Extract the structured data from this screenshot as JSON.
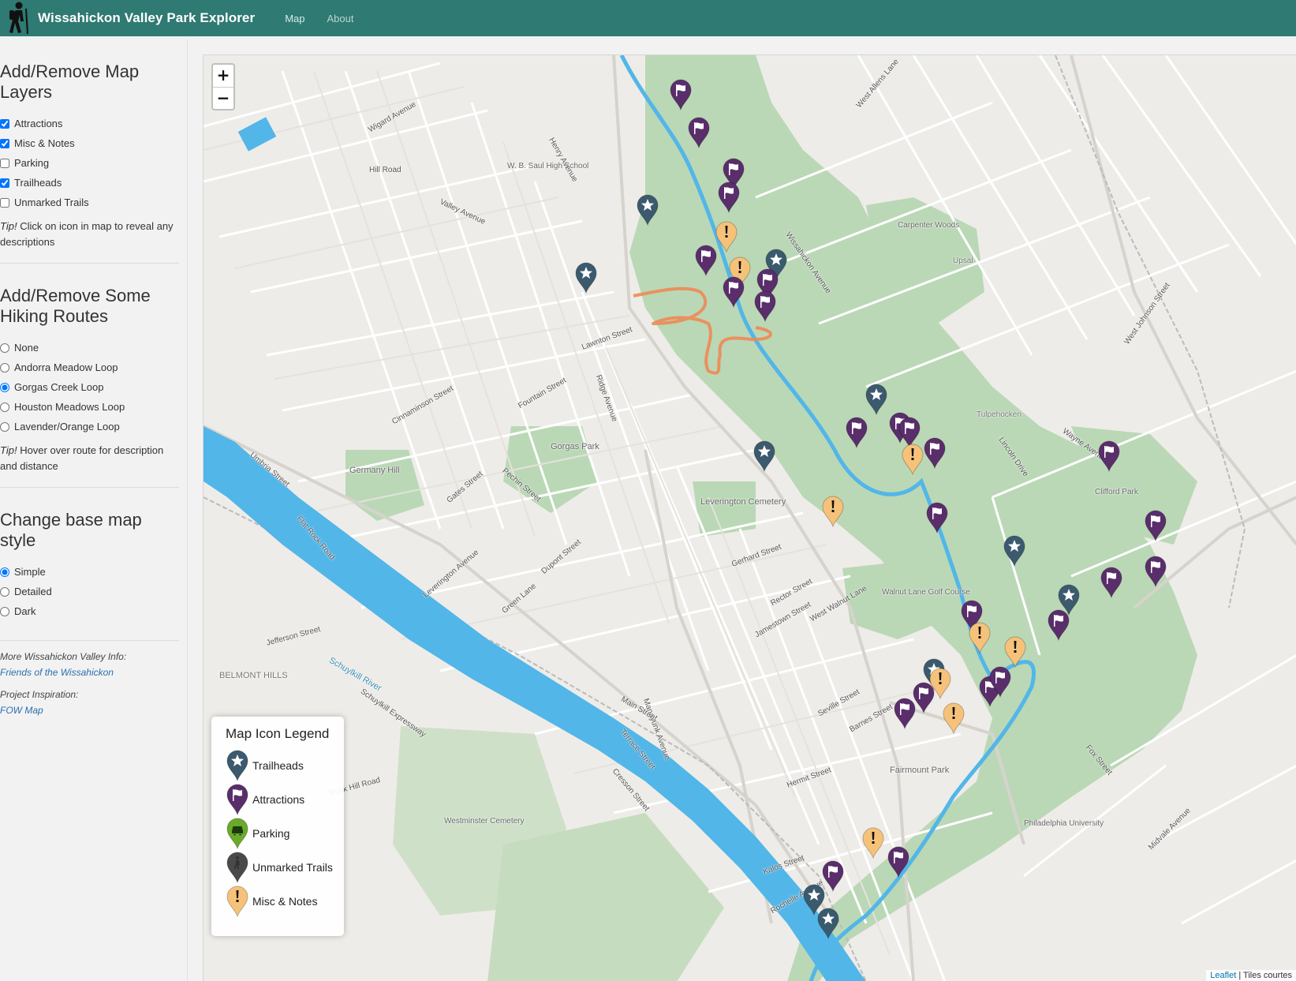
{
  "nav": {
    "title": "Wissahickon Valley Park Explorer",
    "links": [
      "Map",
      "About"
    ]
  },
  "sidebar": {
    "layers_heading": "Add/Remove Map Layers",
    "layers": [
      {
        "label": "Attractions",
        "checked": true
      },
      {
        "label": "Misc & Notes",
        "checked": true
      },
      {
        "label": "Parking",
        "checked": false
      },
      {
        "label": "Trailheads",
        "checked": true
      },
      {
        "label": "Unmarked Trails",
        "checked": false
      }
    ],
    "layers_tip_prefix": "Tip!",
    "layers_tip": "Click on icon in map to reveal any descriptions",
    "routes_heading": "Add/Remove Some Hiking Routes",
    "routes": [
      {
        "label": "None",
        "selected": false
      },
      {
        "label": "Andorra Meadow Loop",
        "selected": false
      },
      {
        "label": "Gorgas Creek Loop",
        "selected": true
      },
      {
        "label": "Houston Meadows Loop",
        "selected": false
      },
      {
        "label": "Lavender/Orange Loop",
        "selected": false
      }
    ],
    "routes_tip_prefix": "Tip!",
    "routes_tip": "Hover over route for description and distance",
    "basemap_heading": "Change base map style",
    "basemaps": [
      {
        "label": "Simple",
        "selected": true
      },
      {
        "label": "Detailed",
        "selected": false
      },
      {
        "label": "Dark",
        "selected": false
      }
    ],
    "more_info_label": "More Wissahickon Valley Info:",
    "more_info_link": "Friends of the Wissahickon",
    "inspiration_label": "Project Inspiration:",
    "inspiration_link": "FOW Map"
  },
  "map": {
    "zoom_in": "+",
    "zoom_out": "−",
    "legend": {
      "title": "Map Icon Legend",
      "items": [
        {
          "label": "Trailheads",
          "color": "#3b5a6e",
          "icon": "star-icon"
        },
        {
          "label": "Attractions",
          "color": "#5a2d6b",
          "icon": "flag-icon"
        },
        {
          "label": "Parking",
          "color": "#6aaa2a",
          "icon": "car-icon"
        },
        {
          "label": "Unmarked Trails",
          "color": "#4a4a4a",
          "icon": "hiker-icon"
        },
        {
          "label": "Misc & Notes",
          "color": "#f6c27a",
          "icon": "exclamation-icon"
        }
      ]
    },
    "attribution_link": "Leaflet",
    "attribution_text": "| Tiles courtes",
    "place_labels": [
      "Germany Hill",
      "Gorgas Park",
      "Leverington Cemetery",
      "Walnut Lane Golf Course",
      "Fairmount Park",
      "Westminster Cemetery",
      "Carpenter Woods",
      "Clifford Park",
      "Philadelphia University",
      "BELMONT HILLS",
      "W. B. Saul High School",
      "Schuylkill River",
      "Henry Avenue",
      "Ridge Avenue",
      "Wissahickon Avenue",
      "Lincoln Drive",
      "Main Street",
      "Schuylkill Expressway",
      "West Walnut Lane",
      "Leverington Avenue",
      "Umbria Street",
      "West Allens Lane",
      "Green Lane",
      "Valley Avenue",
      "Hill Road",
      "Wigard Avenue",
      "Lawnton Street",
      "Fountain Street",
      "Cinnaminson Street",
      "Jamestown Street",
      "Barnes Street",
      "Rector Street",
      "Gates Street",
      "Pechin Street",
      "Dupont Street",
      "Cresson Street",
      "Terrace Street",
      "Manayunk Avenue",
      "Fox Street",
      "Midvale Avenue",
      "Wayne Avenue",
      "Rock Hill Road",
      "Flat Rock Road",
      "Jefferson Street",
      "West Johnson Street",
      "Rochelle Avenue",
      "Seville Street",
      "Gerhard Street",
      "Kalos Street",
      "Hermit Street",
      "Tulpehocken",
      "Upsal"
    ],
    "colors": {
      "water": "#52b6e8",
      "park": "#bad8b6",
      "route": "#ee8a55",
      "trailhead": "#3b5a6e",
      "attraction": "#5a2d6b",
      "misc": "#f6c27a"
    }
  }
}
